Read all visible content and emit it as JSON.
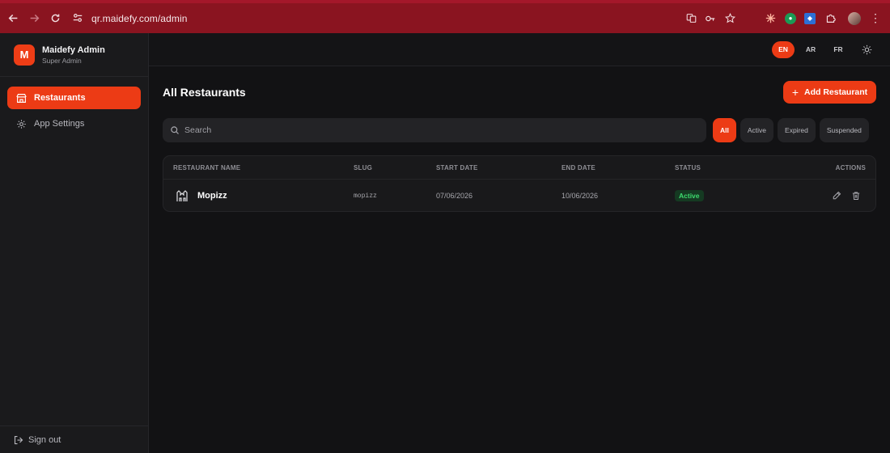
{
  "browser": {
    "url": "qr.maidefy.com/admin"
  },
  "sidebar": {
    "brand_initial": "M",
    "brand_title": "Maidefy Admin",
    "brand_subtitle": "Super Admin",
    "items": [
      {
        "label": "Restaurants",
        "icon": "store-icon",
        "active": true
      },
      {
        "label": "App Settings",
        "icon": "gear-icon",
        "active": false
      }
    ],
    "signout_label": "Sign out"
  },
  "topbar": {
    "languages": [
      {
        "label": "EN",
        "active": true
      },
      {
        "label": "AR",
        "active": false
      },
      {
        "label": "FR",
        "active": false
      }
    ]
  },
  "main": {
    "title": "All Restaurants",
    "add_button_label": "Add Restaurant",
    "search_placeholder": "Search",
    "filters": [
      {
        "label": "All",
        "active": true
      },
      {
        "label": "Active",
        "active": false
      },
      {
        "label": "Expired",
        "active": false
      },
      {
        "label": "Suspended",
        "active": false
      }
    ],
    "table": {
      "headers": [
        "RESTAURANT NAME",
        "SLUG",
        "START DATE",
        "END DATE",
        "STATUS",
        "ACTIONS"
      ],
      "rows": [
        {
          "name": "Mopizz",
          "slug": "mopizz",
          "start_date": "07/06/2026",
          "end_date": "10/06/2026",
          "status": "Active"
        }
      ]
    }
  },
  "colors": {
    "accent": "#ec3b15",
    "status_active": "#3ddb6e",
    "browser_frame": "#8a1420"
  }
}
